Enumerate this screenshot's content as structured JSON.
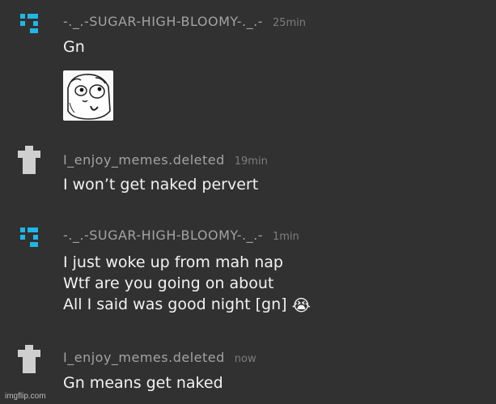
{
  "messages": [
    {
      "username": "-._.-SUGAR-HIGH-BLOOMY-._.-",
      "time": "25min",
      "avatar": "blue-pixel-logo-icon",
      "lines": [
        "Gn"
      ],
      "attachment": "derp-face-meme-image"
    },
    {
      "username": "I_enjoy_memes.deleted",
      "time": "19min",
      "avatar": "deleted-user-placeholder-icon",
      "lines": [
        "I won’t get naked pervert"
      ]
    },
    {
      "username": "-._.-SUGAR-HIGH-BLOOMY-._.-",
      "time": "1min",
      "avatar": "blue-pixel-logo-icon",
      "lines": [
        "I just woke up from mah nap",
        "Wtf are you going on about",
        "All I said was good night [gn]"
      ],
      "emoji": "😭"
    },
    {
      "username": "I_enjoy_memes.deleted",
      "time": "now",
      "avatar": "deleted-user-placeholder-icon",
      "lines": [
        "Gn means get naked"
      ]
    }
  ],
  "watermark": "imgflip.com",
  "colors": {
    "background": "#313131",
    "username": "#a3a3a3",
    "timestamp": "#7d7d7d",
    "message_text": "#f2f2f2",
    "avatar_accent": "#1fb6e8",
    "deleted_avatar": "#cfcfcf"
  }
}
